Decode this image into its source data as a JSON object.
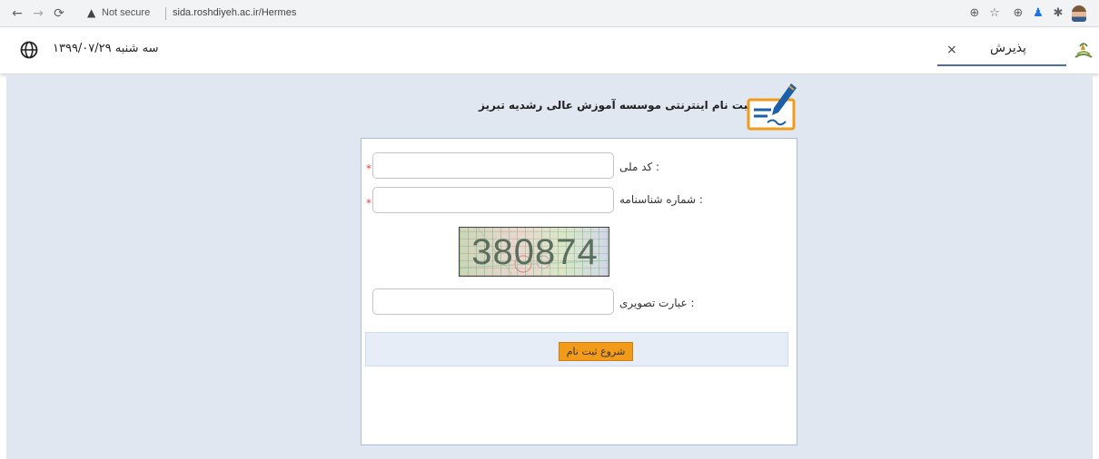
{
  "browser": {
    "url_warning": "Not secure",
    "url": "sida.roshdiyeh.ac.ir/Hermes"
  },
  "header": {
    "date": "سه شنبه ۱۳۹۹/۰۷/۲۹",
    "tab_label": "پذیرش",
    "tab_close": "×"
  },
  "page": {
    "title": "ثبت نام اینترنتی موسسه آموزش عالی رشدیه تبریز"
  },
  "form": {
    "national_code_label": "کد ملی :",
    "national_code_value": "",
    "birth_cert_label": "شماره شناسنامه :",
    "birth_cert_value": "",
    "required_mark": "*",
    "captcha_text": "380874",
    "captcha_label": "عبارت تصویری :",
    "captcha_value": "",
    "submit_label": "شروع ثبت نام"
  },
  "colors": {
    "page_background": "#e1e7f1",
    "submit_button": "#f29a1a",
    "tab_underline": "#4a6fa5"
  }
}
